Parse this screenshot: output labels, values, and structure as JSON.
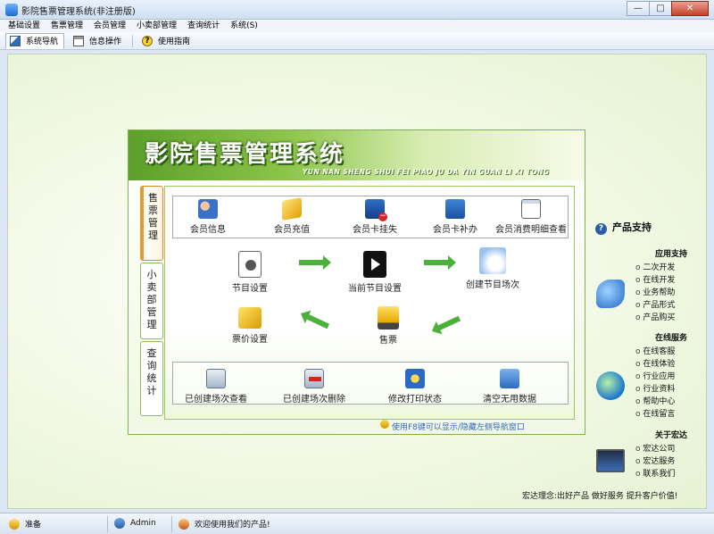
{
  "window": {
    "title": "影院售票管理系统(非注册版)",
    "minimize": "—",
    "maximize": "□",
    "close": "✕"
  },
  "menu": [
    "基础设置",
    "售票管理",
    "会员管理",
    "小卖部管理",
    "查询统计",
    "系统(S)"
  ],
  "toolbar": {
    "nav": "系统导航",
    "info": "信息操作",
    "help": "使用指南"
  },
  "panel": {
    "title": "影院售票管理系统",
    "subtitle": "YUN NAN SHENG SHUI FEI PIAO JU DA YIN GUAN LI XI TONG",
    "tabs": [
      {
        "label": "售\n票\n管\n理",
        "active": true
      },
      {
        "label": "小\n卖\n部\n管\n理",
        "active": false
      },
      {
        "label": "查\n询\n统\n计",
        "active": false
      }
    ],
    "member_row": [
      "会员信息",
      "会员充值",
      "会员卡挂失",
      "会员卡补办",
      "会员消费明细查看"
    ],
    "flow": {
      "program_settings": "节目设置",
      "current_program": "当前节目设置",
      "create_session": "创建节目场次",
      "price_settings": "票价设置",
      "sell_ticket": "售票"
    },
    "session_row": [
      "已创建场次查看",
      "已创建场次删除",
      "修改打印状态",
      "清空无用数据"
    ],
    "hint": "使用F8键可以显示/隐藏左侧导航窗口"
  },
  "support": {
    "title": "产品支持",
    "app_support": {
      "heading": "应用支持",
      "items": [
        "二次开发",
        "在线开发",
        "业务帮助",
        "产品形式",
        "产品购买"
      ]
    },
    "online_service": {
      "heading": "在线服务",
      "items": [
        "在线客服",
        "在线体验",
        "行业应用",
        "行业资料",
        "帮助中心",
        "在线留言"
      ]
    },
    "about": {
      "heading": "关于宏达",
      "items": [
        "宏达公司",
        "宏达服务",
        "联系我们"
      ]
    },
    "motto": "宏达理念:出好产品 做好服务 提升客户价值!"
  },
  "status": {
    "state": "准备",
    "user": "Admin",
    "welcome": "欢迎使用我们的产品!"
  }
}
